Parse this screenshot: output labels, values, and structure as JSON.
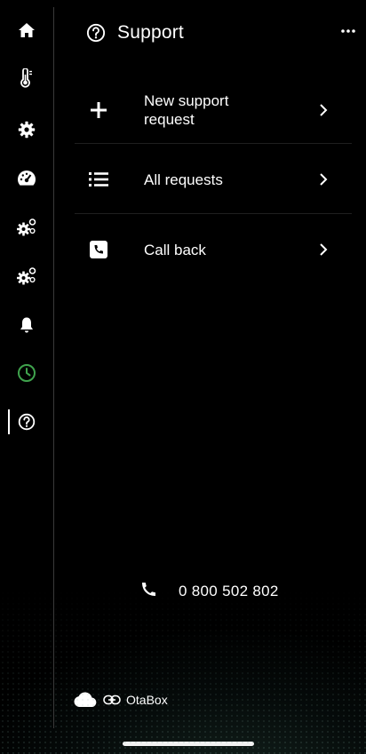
{
  "header": {
    "title": "Support",
    "icon": "help-circle-icon",
    "more_icon": "more-icon"
  },
  "sidebar": {
    "items": [
      {
        "name": "home",
        "icon": "home-icon"
      },
      {
        "name": "temperature",
        "icon": "thermometer-icon"
      },
      {
        "name": "settings",
        "icon": "gear-icon"
      },
      {
        "name": "dashboard",
        "icon": "gauge-icon"
      },
      {
        "name": "system-settings-1",
        "icon": "gears-icon"
      },
      {
        "name": "system-settings-2",
        "icon": "gears-icon"
      },
      {
        "name": "notifications",
        "icon": "bell-icon"
      },
      {
        "name": "history",
        "icon": "clock-icon"
      },
      {
        "name": "support",
        "icon": "help-circle-icon",
        "active": true
      }
    ],
    "accent_color": "#3fa34d"
  },
  "menu": {
    "items": [
      {
        "label": "New support request",
        "icon": "plus-icon"
      },
      {
        "label": "All requests",
        "icon": "list-icon"
      },
      {
        "label": "Call back",
        "icon": "phone-callback-icon"
      }
    ]
  },
  "footer": {
    "phone_number": "0 800 502 802",
    "connection_label": "OtaBox"
  }
}
